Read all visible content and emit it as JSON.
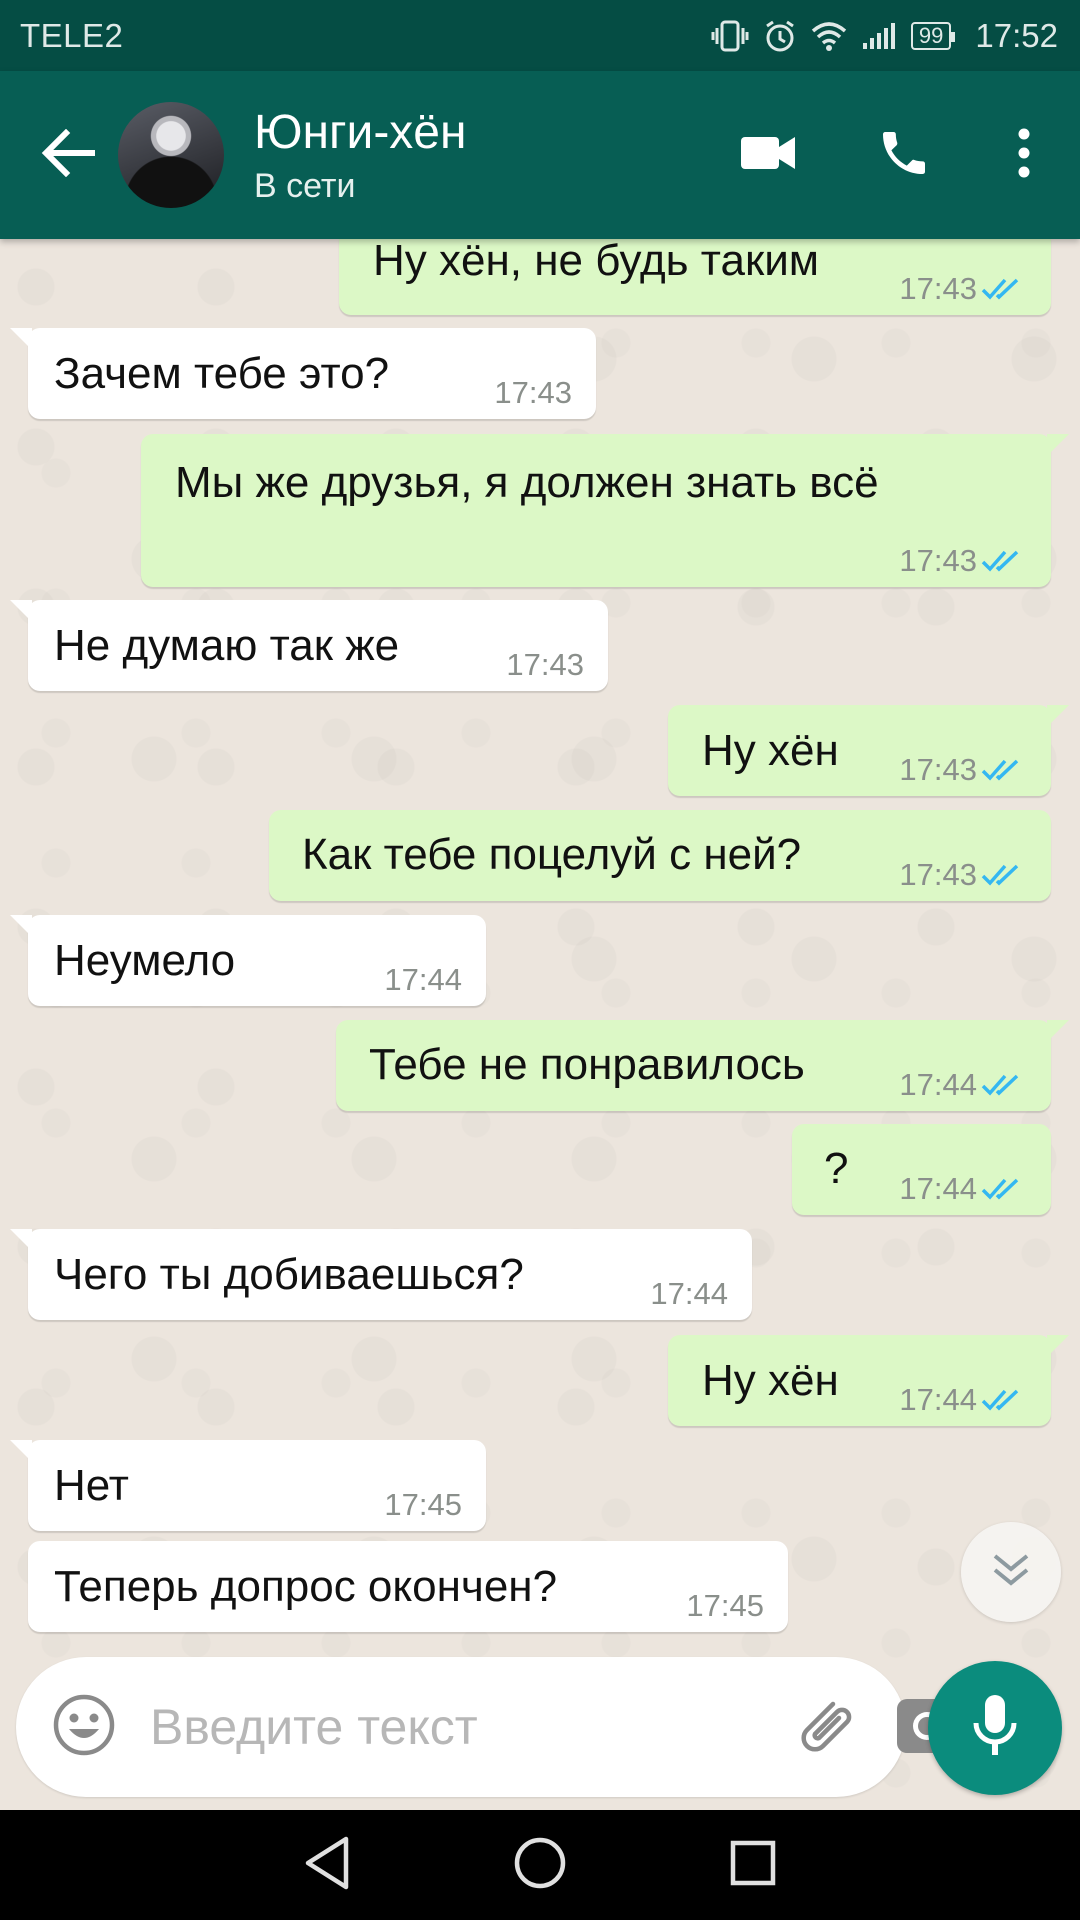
{
  "status_bar": {
    "carrier": "TELE2",
    "battery": "99",
    "time": "17:52"
  },
  "toolbar": {
    "contact_name": "Юнги-хён",
    "contact_status": "В сети",
    "icons": [
      "back-arrow-icon",
      "avatar",
      "video-call-icon",
      "phone-icon",
      "more-vert-icon"
    ]
  },
  "messages": [
    {
      "dir": "out",
      "text": "Ну хён, не будь таким",
      "time": "17:43",
      "read": true
    },
    {
      "dir": "in",
      "text": "Зачем тебе это?",
      "time": "17:43"
    },
    {
      "dir": "out",
      "text": "Мы же друзья, я должен знать всё",
      "time": "17:43",
      "read": true
    },
    {
      "dir": "in",
      "text": "Не думаю так же",
      "time": "17:43"
    },
    {
      "dir": "out",
      "text": "Ну хён",
      "time": "17:43",
      "read": true
    },
    {
      "dir": "out",
      "text": "Как тебе поцелуй с ней?",
      "time": "17:43",
      "read": true
    },
    {
      "dir": "in",
      "text": "Неумело",
      "time": "17:44"
    },
    {
      "dir": "out",
      "text": "Тебе не понравилось",
      "time": "17:44",
      "read": true
    },
    {
      "dir": "out",
      "text": "?",
      "time": "17:44",
      "read": true
    },
    {
      "dir": "in",
      "text": "Чего ты добиваешься?",
      "time": "17:44"
    },
    {
      "dir": "out",
      "text": "Ну хён",
      "time": "17:44",
      "read": true
    },
    {
      "dir": "in",
      "text": "Нет",
      "time": "17:45"
    },
    {
      "dir": "in",
      "text": "Теперь допрос окончен?",
      "time": "17:45"
    }
  ],
  "composer": {
    "placeholder": "Введите текст",
    "value": ""
  },
  "colors": {
    "header": "#075e54",
    "status_bar": "#054d44",
    "outgoing_bubble": "#dcf8c6",
    "incoming_bubble": "#ffffff",
    "chat_background": "#ece5dd",
    "read_ticks": "#34b7f1",
    "mic_button": "#0b8c7d"
  }
}
